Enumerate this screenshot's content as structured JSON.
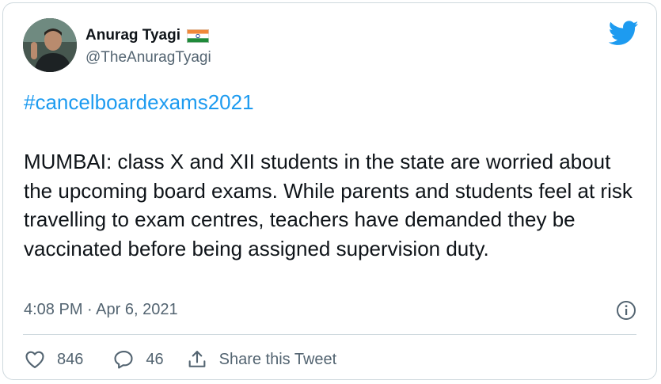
{
  "author": {
    "name": "Anurag Tyagi",
    "handle": "@TheAnuragTyagi",
    "flag_icon": "india-flag-icon"
  },
  "tweet": {
    "hashtag": "#cancelboardexams2021",
    "text": "MUMBAI: class X and XII students in the state are worried about the upcoming board exams. While parents and students feel at risk travelling to exam centres, teachers have demanded they be vaccinated before being assigned supervision duty.",
    "timestamp": "4:08 PM · Apr 6, 2021"
  },
  "actions": {
    "like_count": "846",
    "reply_count": "46",
    "share_label": "Share this Tweet"
  },
  "colors": {
    "twitter_blue": "#1d9bf0",
    "text": "#0f1419",
    "secondary": "#536471",
    "border": "#cfd9de"
  }
}
